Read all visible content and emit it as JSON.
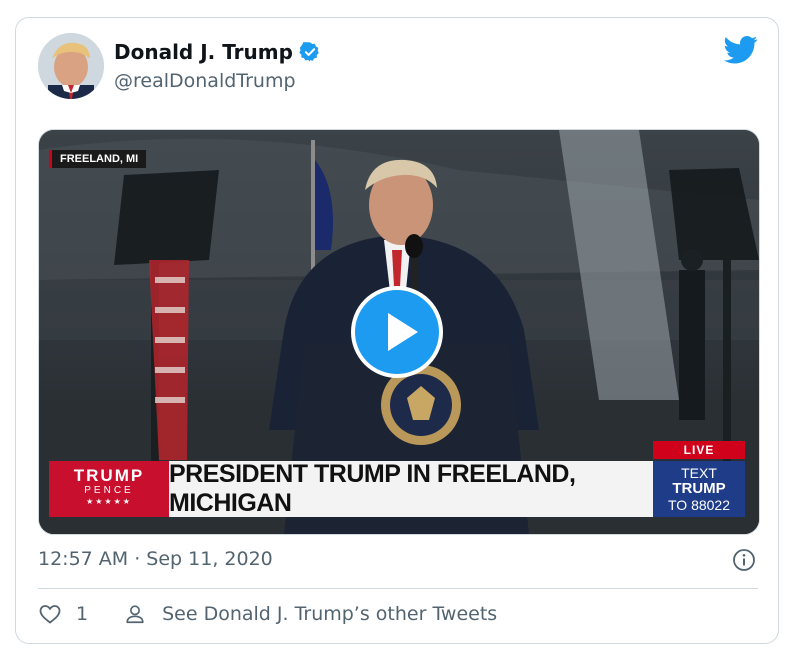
{
  "tweet": {
    "author_name": "Donald J. Trump",
    "handle": "@realDonaldTrump",
    "timestamp": "12:57 AM · Sep 11, 2020",
    "likes": "1",
    "other_tweets_link": "See Donald J. Trump’s other Tweets"
  },
  "video": {
    "location_tag": "FREELAND, MI",
    "live_label": "LIVE",
    "logo_line1": "TRUMP",
    "logo_line2": "PENCE",
    "logo_stars": "★★★★★",
    "headline": "PRESIDENT TRUMP IN FREELAND, MICHIGAN",
    "text_line1": "TEXT",
    "text_line2": "TRUMP",
    "text_line3": "TO 88022"
  },
  "colors": {
    "twitter_blue": "#1d9bf0",
    "muted_text": "#536471",
    "live_red": "#d0021b",
    "campaign_red": "#c8102e",
    "campaign_blue": "#1f3c88"
  },
  "icons": [
    "verified-badge-icon",
    "twitter-bird-icon",
    "play-icon",
    "info-icon",
    "heart-icon",
    "person-icon"
  ]
}
